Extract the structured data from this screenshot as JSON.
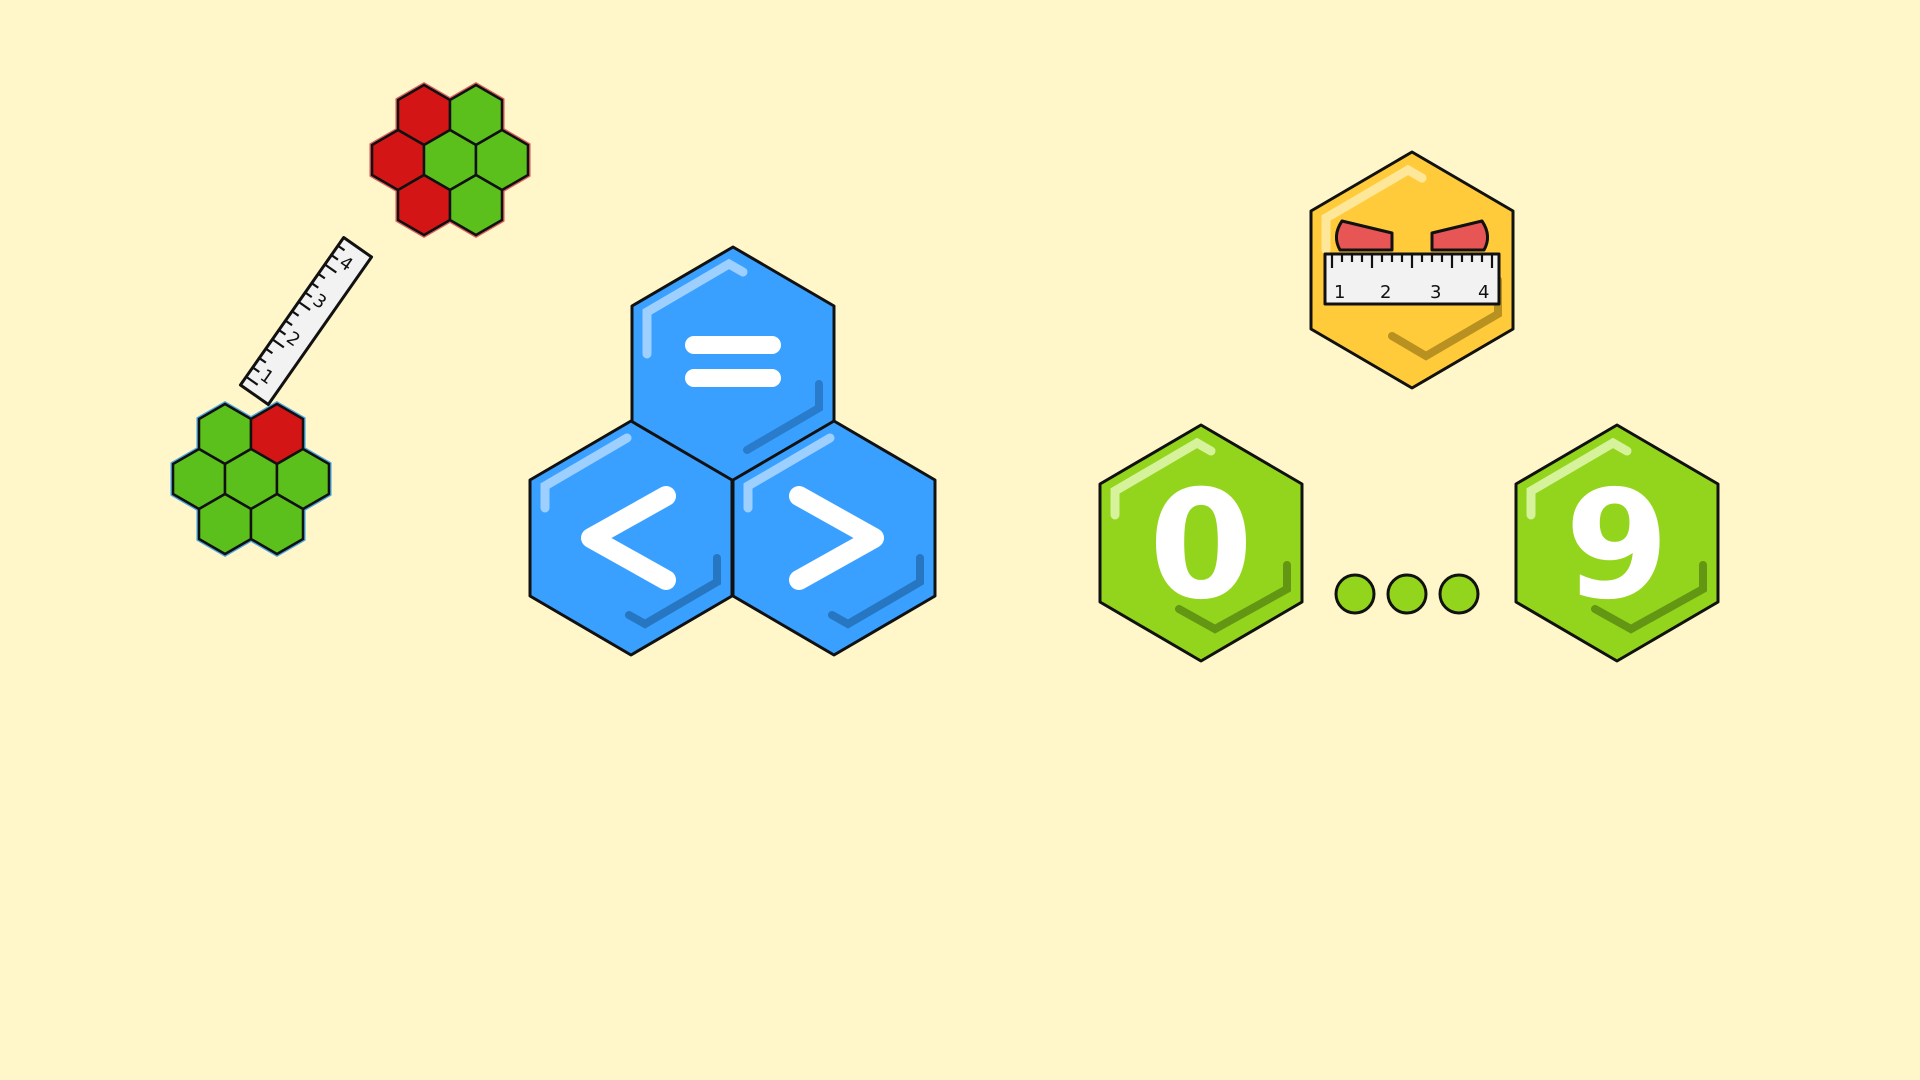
{
  "colors": {
    "background": "#FFF7C9",
    "hex_red": "#D41515",
    "hex_green": "#5BBF1C",
    "cluster_outline_red": "#E06060",
    "cluster_outline_blue": "#4FA8E0",
    "blue": "#3AA0FF",
    "blue_shadow": "#1E64A8",
    "yellow": "#FFCB3A",
    "lime": "#93D51C",
    "lime_dot": "#93D51C",
    "eye_red": "#E85555",
    "ruler": "#F2F2F2"
  },
  "icons": {
    "hex_cluster_top": "hex-cluster-icon",
    "hex_cluster_bottom": "hex-cluster-icon",
    "ruler": "ruler-icon",
    "comparison_group": "comparison-symbols-icon",
    "angry_measure_hex": "angry-ruler-face-icon",
    "ellipsis_dots": "ellipsis-icon"
  },
  "cluster_top": {
    "cells": [
      "red",
      "green",
      "red",
      "green",
      "green",
      "red",
      "green"
    ]
  },
  "cluster_bottom": {
    "cells": [
      "green",
      "red",
      "green",
      "green",
      "green",
      "green",
      "green"
    ]
  },
  "ruler_left": {
    "numbers": [
      "1",
      "2",
      "3",
      "4"
    ]
  },
  "ruler_right": {
    "numbers": [
      "1",
      "2",
      "3",
      "4"
    ]
  },
  "compare": {
    "equal": "=",
    "less": "<",
    "greater": ">"
  },
  "digits": {
    "first": "0",
    "last": "9"
  }
}
